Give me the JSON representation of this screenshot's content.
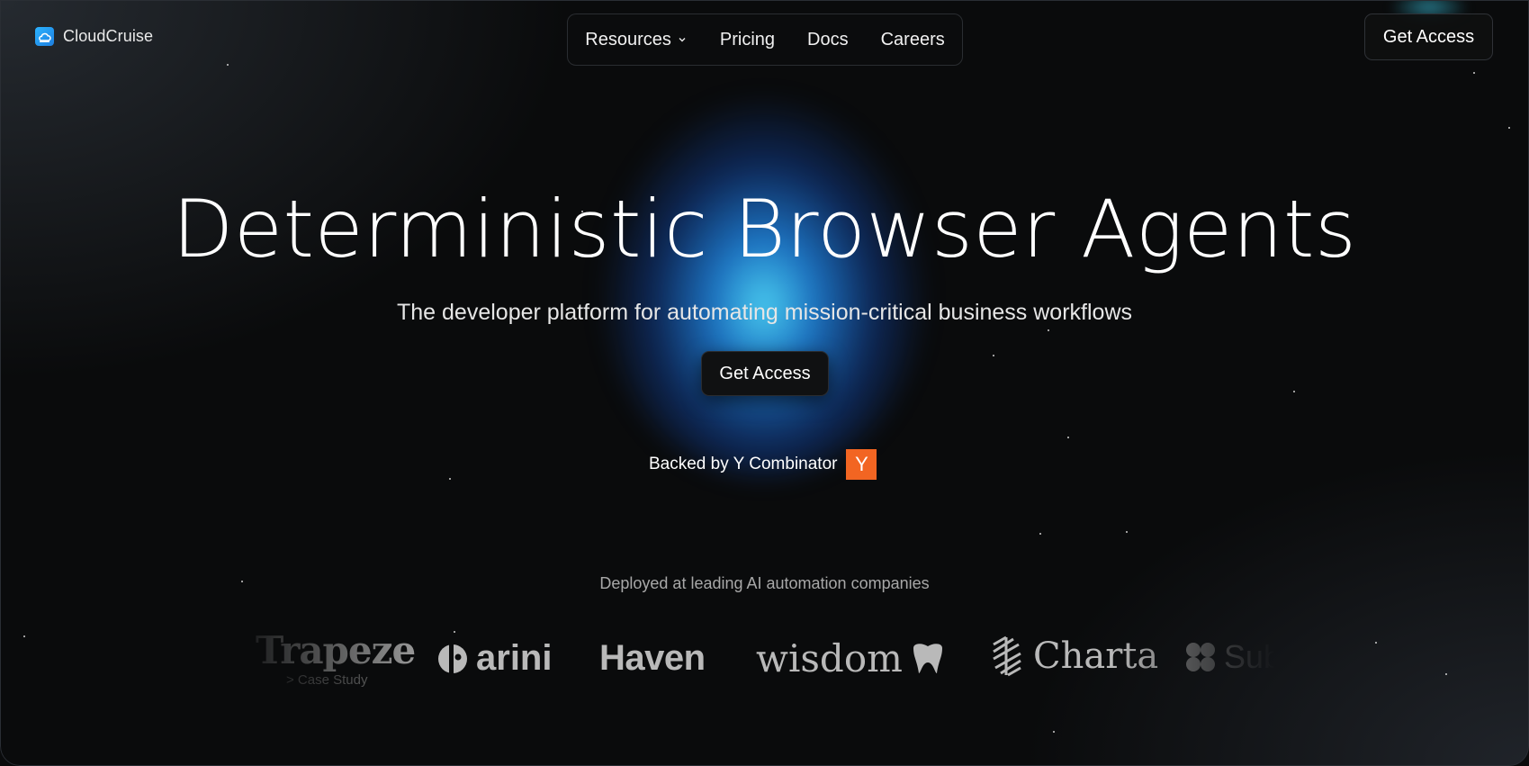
{
  "brand": {
    "name": "CloudCruise",
    "logo_icon": "cloud-icon",
    "accent": "#2bb3ff"
  },
  "nav": {
    "items": [
      {
        "label": "Resources",
        "has_dropdown": true
      },
      {
        "label": "Pricing"
      },
      {
        "label": "Docs"
      },
      {
        "label": "Careers"
      }
    ]
  },
  "header": {
    "cta_label": "Get Access"
  },
  "hero": {
    "title": "Deterministic Browser Agents",
    "subtitle": "The developer platform for automating mission-critical business workflows",
    "cta_label": "Get Access",
    "backed_text": "Backed by Y Combinator",
    "yc_badge": "Y",
    "yc_color": "#f26522"
  },
  "customers": {
    "heading": "Deployed at leading AI automation companies",
    "logos": [
      {
        "name": "Trapeze",
        "caption": "> Case Study"
      },
      {
        "name": "arini"
      },
      {
        "name": "Haven"
      },
      {
        "name": "wisdom"
      },
      {
        "name": "Charta"
      },
      {
        "name": "Sub"
      }
    ]
  }
}
